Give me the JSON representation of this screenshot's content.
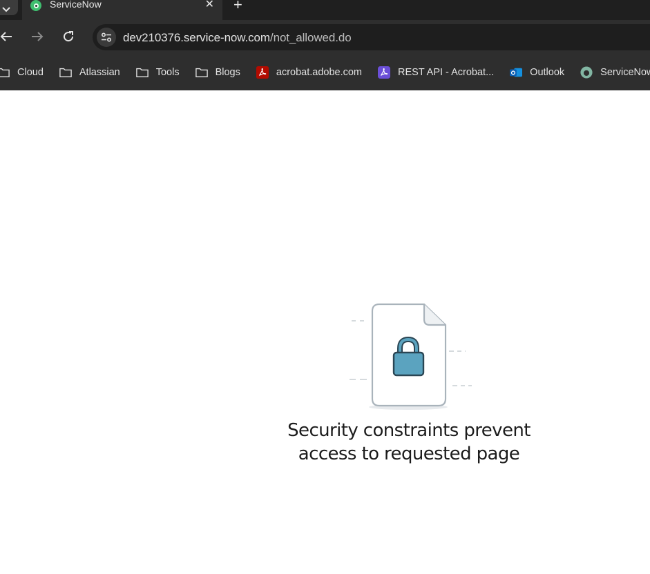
{
  "browser": {
    "tab": {
      "title": "ServiceNow",
      "close_glyph": "✕",
      "favicon": "servicenow-icon"
    },
    "new_tab_glyph": "+",
    "tab_menu_glyph": "⌄",
    "address": {
      "host": "dev210376.service-now.com",
      "path": "/not_allowed.do"
    },
    "bookmarks": [
      {
        "label": "Cloud",
        "icon": "folder-icon"
      },
      {
        "label": "Atlassian",
        "icon": "folder-icon"
      },
      {
        "label": "Tools",
        "icon": "folder-icon"
      },
      {
        "label": "Blogs",
        "icon": "folder-icon"
      },
      {
        "label": "acrobat.adobe.com",
        "icon": "adobe-acrobat-icon"
      },
      {
        "label": "REST API - Acrobat...",
        "icon": "acrobat-services-icon"
      },
      {
        "label": "Outlook",
        "icon": "outlook-icon"
      },
      {
        "label": "ServiceNow",
        "icon": "servicenow-icon"
      }
    ]
  },
  "page": {
    "message_line1": "Security constraints prevent",
    "message_line2": "access to requested page",
    "illustration": "locked-document-icon"
  },
  "colors": {
    "lock": "#5ba3bf",
    "lock_dark": "#2a4553",
    "doc_stroke": "#a9b3bb"
  }
}
